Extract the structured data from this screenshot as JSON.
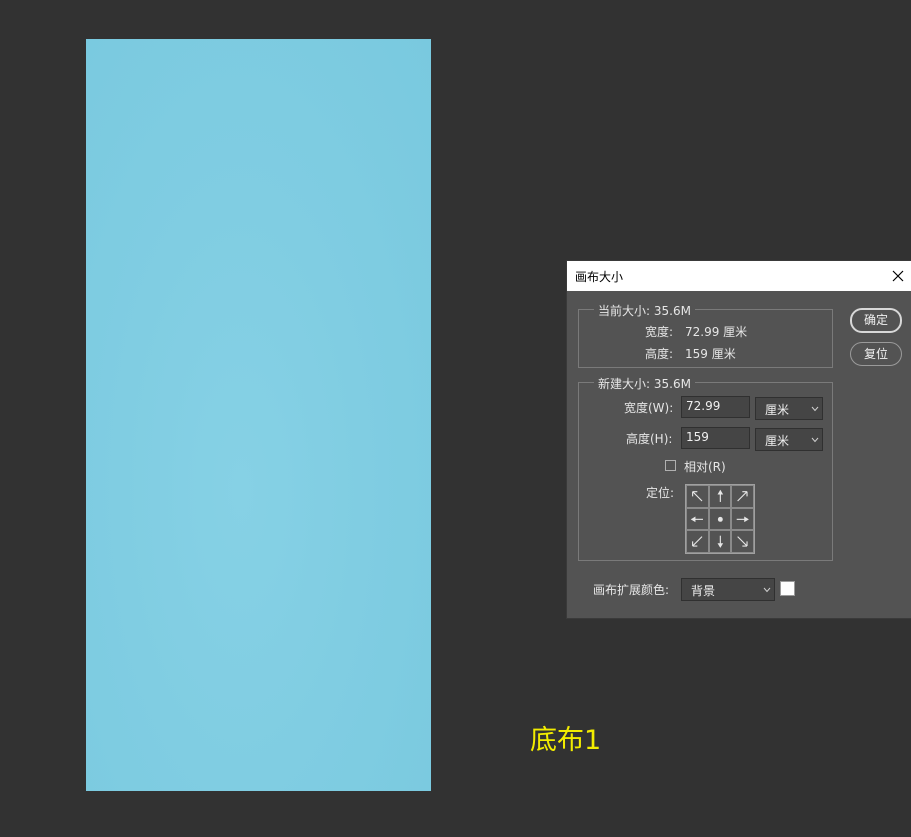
{
  "canvas": {
    "color": "#80cde2"
  },
  "caption": {
    "text": "底布1",
    "color": "#f2ec00"
  },
  "dialog": {
    "title": "画布大小",
    "close_icon": "close-icon",
    "buttons": {
      "ok": "确定",
      "reset": "复位"
    },
    "current_size": {
      "legend": "当前大小: 35.6M",
      "width_label": "宽度:",
      "width_value": "72.99 厘米",
      "height_label": "高度:",
      "height_value": "159 厘米"
    },
    "new_size": {
      "legend": "新建大小: 35.6M",
      "width_label": "宽度(W):",
      "width_value": "72.99",
      "width_unit": "厘米",
      "height_label": "高度(H):",
      "height_value": "159",
      "height_unit": "厘米",
      "relative_label": "相对(R)",
      "relative_checked": false,
      "anchor_label": "定位:",
      "anchor_selected": "center"
    },
    "extension_color": {
      "label": "画布扩展颜色:",
      "value": "背景",
      "swatch_color": "#ffffff"
    }
  }
}
